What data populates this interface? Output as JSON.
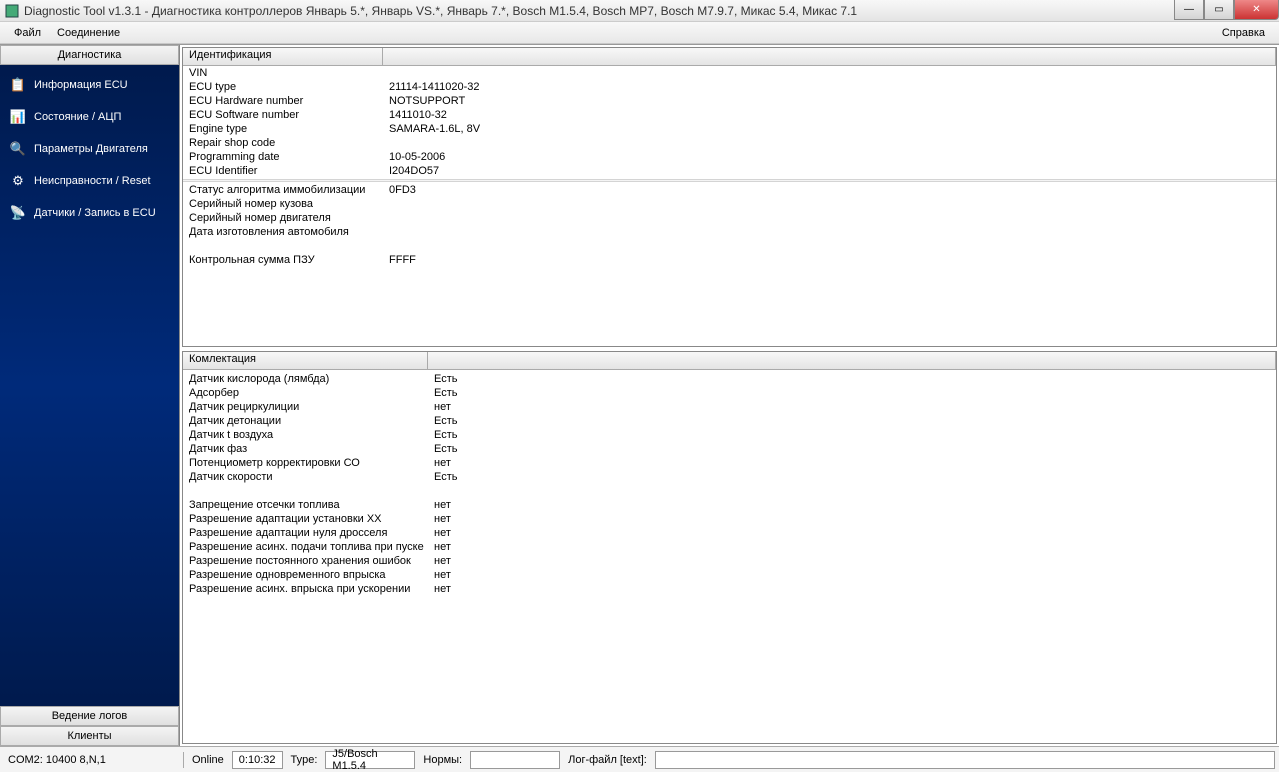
{
  "window": {
    "title": "Diagnostic Tool v1.3.1 - Диагностика контроллеров Январь 5.*, Январь VS.*, Январь 7.*, Bosch M1.5.4, Bosch MP7, Bosch M7.9.7, Микас 5.4, Микас 7.1"
  },
  "menu": {
    "file": "Файл",
    "connection": "Соединение",
    "help": "Справка"
  },
  "sidebar": {
    "header": "Диагностика",
    "items": [
      {
        "label": "Информация ECU",
        "icon": "📋"
      },
      {
        "label": "Состояние / АЦП",
        "icon": "📊"
      },
      {
        "label": "Параметры Двигателя",
        "icon": "🔍"
      },
      {
        "label": "Неисправности / Reset",
        "icon": "⚙"
      },
      {
        "label": "Датчики / Запись в ECU",
        "icon": "📡"
      }
    ],
    "footer1": "Ведение логов",
    "footer2": "Клиенты"
  },
  "ident": {
    "header": "Идентификация",
    "rows": [
      {
        "label": "VIN",
        "value": ""
      },
      {
        "label": "ECU type",
        "value": "21114-1411020-32"
      },
      {
        "label": "ECU Hardware number",
        "value": "NOTSUPPORT"
      },
      {
        "label": "ECU Software number",
        "value": "1411010-32"
      },
      {
        "label": "Engine type",
        "value": "SAMARA-1.6L, 8V"
      },
      {
        "label": "Repair shop code",
        "value": ""
      },
      {
        "label": "Programming date",
        "value": "10-05-2006"
      },
      {
        "label": "ECU Identifier",
        "value": "I204DO57"
      }
    ],
    "rows2": [
      {
        "label": "Статус алгоритма иммобилизации",
        "value": "0FD3"
      },
      {
        "label": "Серийный номер кузова",
        "value": ""
      },
      {
        "label": "Серийный номер двигателя",
        "value": ""
      },
      {
        "label": "Дата изготовления автомобиля",
        "value": ""
      }
    ],
    "rows3": [
      {
        "label": "Контрольная сумма ПЗУ",
        "value": "FFFF"
      }
    ]
  },
  "equip": {
    "header": "Комлектация",
    "rows": [
      {
        "label": "Датчик кислорода (лямбда)",
        "value": "Есть"
      },
      {
        "label": "Адсорбер",
        "value": "Есть"
      },
      {
        "label": "Датчик рециркулиции",
        "value": "нет"
      },
      {
        "label": "Датчик детонации",
        "value": "Есть"
      },
      {
        "label": "Датчик t воздуха",
        "value": "Есть"
      },
      {
        "label": "Датчик фаз",
        "value": "Есть"
      },
      {
        "label": "Потенциометр корректировки СО",
        "value": "нет"
      },
      {
        "label": "Датчик скорости",
        "value": "Есть"
      }
    ],
    "rows2": [
      {
        "label": "Запрещение отсечки топлива",
        "value": "нет"
      },
      {
        "label": "Разрешение адаптации установки ХХ",
        "value": "нет"
      },
      {
        "label": "Разрешение адаптации нуля дросселя",
        "value": "нет"
      },
      {
        "label": "Разрешение асинх. подачи топлива при пуске",
        "value": "нет"
      },
      {
        "label": "Разрешение постоянного хранения ошибок",
        "value": "нет"
      },
      {
        "label": "Разрешение одновременного впрыска",
        "value": "нет"
      },
      {
        "label": "Разрешение асинх. впрыска при ускорении",
        "value": "нет"
      }
    ]
  },
  "status": {
    "com": "COM2: 10400 8,N,1",
    "online": "Online",
    "time": "0:10:32",
    "type_label": "Type:",
    "type_value": "J5/Bosch M1.5.4",
    "norms_label": "Нормы:",
    "log_label": "Лог-файл [text]:"
  }
}
